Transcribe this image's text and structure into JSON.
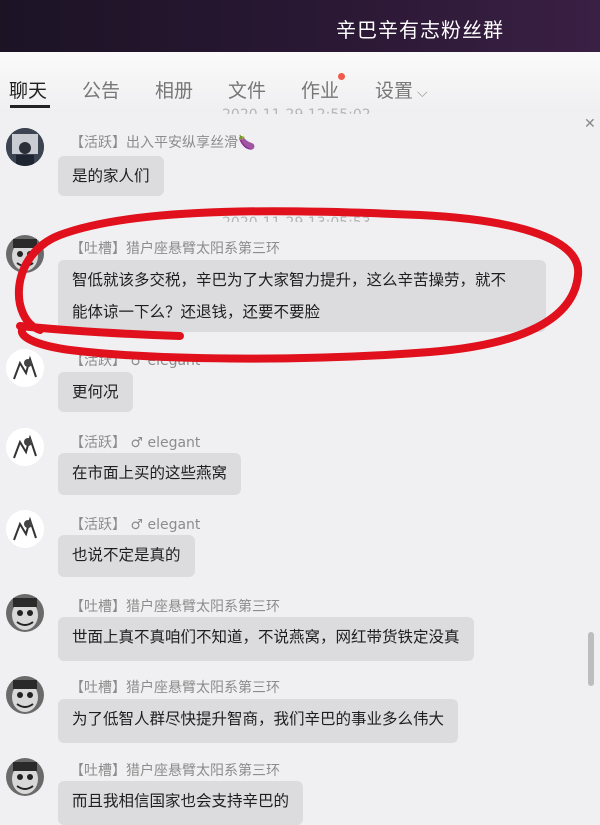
{
  "window": {
    "title": "辛巴辛有志粉丝群"
  },
  "tabs": [
    {
      "label": "聊天",
      "active": true
    },
    {
      "label": "公告"
    },
    {
      "label": "相册"
    },
    {
      "label": "文件"
    },
    {
      "label": "作业",
      "has_notification_dot": true
    },
    {
      "label": "设置",
      "has_dropdown": true
    }
  ],
  "timestamps": [
    "2020-11-29 12:55:02",
    "2020-11-29 13:05:53"
  ],
  "messages": [
    {
      "tag": "【活跃】",
      "sender": "出入平安纵享丝滑🍆",
      "text": "是的家人们",
      "avatar": "photo"
    },
    {
      "tag": "【吐槽】",
      "sender": "猎户座悬臂太阳系第三环",
      "text1": "智低就该多交税，辛巴为了大家智力提升，这么辛苦操劳，就不",
      "text2": "能体谅一下么？还退钱，还要不要脸",
      "avatar": "joker"
    },
    {
      "tag": "【活跃】",
      "gender": "♂",
      "sender": "elegant",
      "text": "更何况",
      "avatar": "sketch"
    },
    {
      "tag": "【活跃】",
      "gender": "♂",
      "sender": "elegant",
      "text": "在市面上买的这些燕窝",
      "avatar": "sketch"
    },
    {
      "tag": "【活跃】",
      "gender": "♂",
      "sender": "elegant",
      "text": "也说不定是真的",
      "avatar": "sketch"
    },
    {
      "tag": "【吐槽】",
      "sender": "猎户座悬臂太阳系第三环",
      "text": "世面上真不真咱们不知道，不说燕窝，网红带货铁定没真",
      "avatar": "joker"
    },
    {
      "tag": "【吐槽】",
      "sender": "猎户座悬臂太阳系第三环",
      "text": "为了低智人群尽快提升智商，我们辛巴的事业多么伟大",
      "avatar": "joker"
    },
    {
      "tag": "【吐槽】",
      "sender": "猎户座悬臂太阳系第三环",
      "text": "而且我相信国家也会支持辛巴的",
      "avatar": "joker"
    }
  ],
  "icons": {
    "close": "close-icon",
    "dropdown": "chevron-down-icon"
  },
  "colors": {
    "title_bar": "#2a1834",
    "notification_dot": "#f05a4a",
    "annotation_circle": "#e0101c",
    "bubble": "#dcdcdf"
  }
}
